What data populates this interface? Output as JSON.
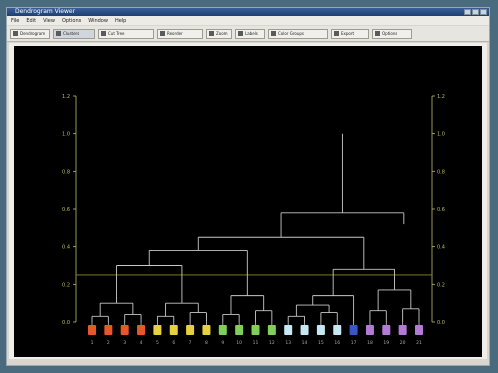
{
  "window": {
    "title": "Dendrogram Viewer"
  },
  "menubar": {
    "items": [
      "File",
      "Edit",
      "View",
      "Options",
      "Window",
      "Help"
    ]
  },
  "toolbar": {
    "buttons": [
      {
        "label": "Dendrogram",
        "selected": false
      },
      {
        "label": "Clusters",
        "selected": true
      },
      {
        "label": "Cut Tree",
        "selected": false
      },
      {
        "label": "Reorder",
        "selected": false
      },
      {
        "label": "Zoom",
        "selected": false
      },
      {
        "label": "Labels",
        "selected": false
      },
      {
        "label": "Color Groups",
        "selected": false
      },
      {
        "label": "Export",
        "selected": false
      },
      {
        "label": "Options",
        "selected": false
      }
    ]
  },
  "dendrogram": {
    "leaves": [
      {
        "label": "1",
        "color": "#e8562a"
      },
      {
        "label": "2",
        "color": "#e8562a"
      },
      {
        "label": "3",
        "color": "#e8562a"
      },
      {
        "label": "4",
        "color": "#e8562a"
      },
      {
        "label": "5",
        "color": "#e8d23a"
      },
      {
        "label": "6",
        "color": "#e8d23a"
      },
      {
        "label": "7",
        "color": "#e8d23a"
      },
      {
        "label": "8",
        "color": "#e8d23a"
      },
      {
        "label": "9",
        "color": "#7fcf5a"
      },
      {
        "label": "10",
        "color": "#7fcf5a"
      },
      {
        "label": "11",
        "color": "#7fcf5a"
      },
      {
        "label": "12",
        "color": "#7fcf5a"
      },
      {
        "label": "13",
        "color": "#c6e8f2"
      },
      {
        "label": "14",
        "color": "#c6e8f2"
      },
      {
        "label": "15",
        "color": "#c6e8f2"
      },
      {
        "label": "16",
        "color": "#c6e8f2"
      },
      {
        "label": "17",
        "color": "#3a55c8"
      },
      {
        "label": "18",
        "color": "#b47bd6"
      },
      {
        "label": "19",
        "color": "#b47bd6"
      },
      {
        "label": "20",
        "color": "#b47bd6"
      },
      {
        "label": "21",
        "color": "#b47bd6"
      }
    ],
    "left_axis_ticks": [
      "0.0",
      "0.2",
      "0.4",
      "0.6",
      "0.8",
      "1.0",
      "1.2"
    ],
    "right_axis_ticks": [
      "0.0",
      "0.2",
      "0.4",
      "0.6",
      "0.8",
      "1.0",
      "1.2"
    ],
    "ylabel": "",
    "cut_height": 0.25,
    "cut_line_color": "#8a8a30",
    "line_color": "#c8c8c8",
    "axis_color": "#bdbd6a"
  }
}
